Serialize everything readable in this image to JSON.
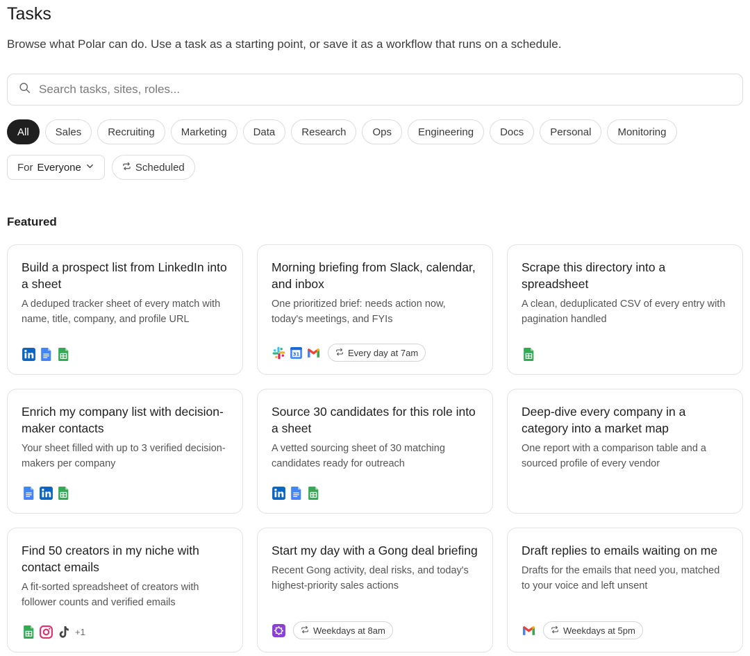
{
  "page": {
    "title": "Tasks",
    "subtitle": "Browse what Polar can do. Use a task as a starting point, or save it as a workflow that runs on a schedule."
  },
  "search": {
    "placeholder": "Search tasks, sites, roles..."
  },
  "categories": [
    "All",
    "Sales",
    "Recruiting",
    "Marketing",
    "Data",
    "Research",
    "Ops",
    "Engineering",
    "Docs",
    "Personal",
    "Monitoring"
  ],
  "active_category": "All",
  "filters": {
    "audience_prefix": "For",
    "audience_value": "Everyone",
    "scheduled_label": "Scheduled"
  },
  "section_title": "Featured",
  "cards": [
    {
      "title": "Build a prospect list from LinkedIn into a sheet",
      "desc": "A deduped tracker sheet of every match with name, title, company, and profile URL",
      "icons": [
        "linkedin-icon",
        "google-docs-icon",
        "google-sheets-icon"
      ]
    },
    {
      "title": "Morning briefing from Slack, calendar, and inbox",
      "desc": "One prioritized brief: needs action now, today's meetings, and FYIs",
      "icons": [
        "slack-icon",
        "google-calendar-icon",
        "gmail-icon"
      ],
      "schedule": "Every day at 7am"
    },
    {
      "title": "Scrape this directory into a spreadsheet",
      "desc": "A clean, deduplicated CSV of every entry with pagination handled",
      "icons": [
        "google-sheets-icon"
      ]
    },
    {
      "title": "Enrich my company list with decision-maker contacts",
      "desc": "Your sheet filled with up to 3 verified decision-makers per company",
      "icons": [
        "google-docs-icon",
        "linkedin-icon",
        "google-sheets-icon"
      ]
    },
    {
      "title": "Source 30 candidates for this role into a sheet",
      "desc": "A vetted sourcing sheet of 30 matching candidates ready for outreach",
      "icons": [
        "linkedin-icon",
        "google-docs-icon",
        "google-sheets-icon"
      ]
    },
    {
      "title": "Deep-dive every company in a category into a market map",
      "desc": "One report with a comparison table and a sourced profile of every vendor",
      "icons": []
    },
    {
      "title": "Find 50 creators in my niche with contact emails",
      "desc": "A fit-sorted spreadsheet of creators with follower counts and verified emails",
      "icons": [
        "google-sheets-icon",
        "instagram-icon",
        "tiktok-icon"
      ],
      "more": "+1"
    },
    {
      "title": "Start my day with a Gong deal briefing",
      "desc": "Recent Gong activity, deal risks, and today's highest-priority sales actions",
      "icons": [
        "gong-icon"
      ],
      "schedule": "Weekdays at 8am"
    },
    {
      "title": "Draft replies to emails waiting on me",
      "desc": "Drafts for the emails that need you, matched to your voice and left unsent",
      "icons": [
        "gmail-icon"
      ],
      "schedule": "Weekdays at 5pm"
    }
  ],
  "colors": {
    "linkedin": "#0a66c2",
    "google_docs": "#4285f4",
    "google_sheets": "#34a853",
    "gmail_red": "#ea4335",
    "instagram": "#e1306c",
    "gong": "#8b3fd9",
    "active_chip": "#1f1f1f"
  }
}
